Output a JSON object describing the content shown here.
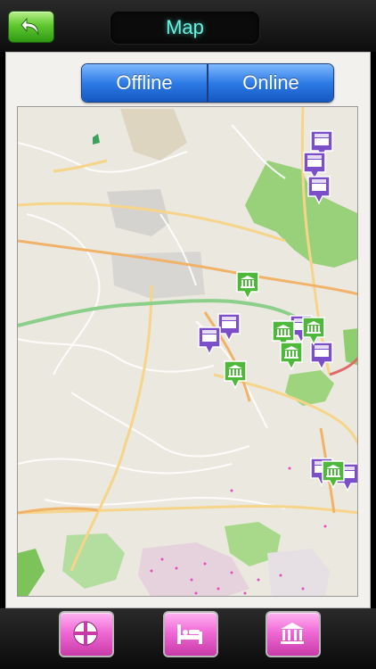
{
  "header": {
    "title": "Map",
    "back_icon": "back-arrow-icon"
  },
  "map_mode": {
    "options": [
      "Offline",
      "Online"
    ]
  },
  "map": {
    "markers": [
      {
        "type": "hotel"
      },
      {
        "type": "hotel"
      },
      {
        "type": "hotel"
      },
      {
        "type": "attraction"
      },
      {
        "type": "hotel"
      },
      {
        "type": "hotel"
      },
      {
        "type": "attraction"
      },
      {
        "type": "attraction"
      },
      {
        "type": "attraction"
      },
      {
        "type": "hotel"
      },
      {
        "type": "attraction"
      },
      {
        "type": "attraction"
      },
      {
        "type": "hotel"
      },
      {
        "type": "attraction"
      },
      {
        "type": "hotel"
      }
    ]
  },
  "bottom_bar": {
    "buttons": [
      {
        "name": "map-view",
        "icon": "crosshair-icon"
      },
      {
        "name": "hotels",
        "icon": "bed-icon"
      },
      {
        "name": "attractions",
        "icon": "museum-icon"
      }
    ]
  },
  "colors": {
    "hotel_marker": "#7a4fc7",
    "attraction_marker": "#4db83a",
    "tab_button": "#f06ad6",
    "segment": "#2e7be6"
  }
}
